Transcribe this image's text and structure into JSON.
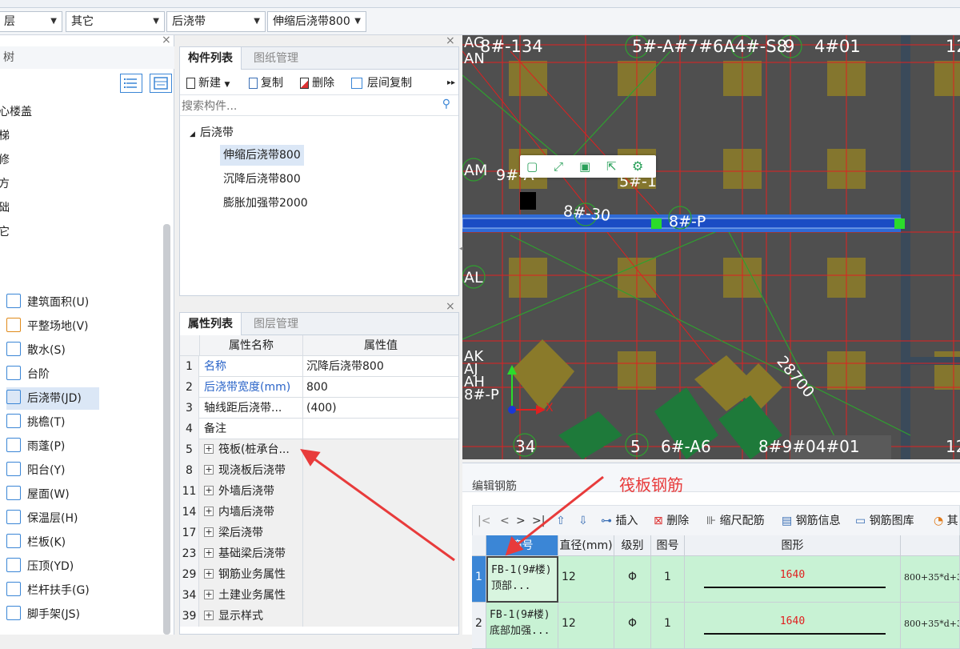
{
  "selectors": {
    "s1": "层",
    "s2": "其它",
    "s3": "后浇带",
    "s4": "伸缩后浇带800"
  },
  "left_tree": {
    "header": "树",
    "items": [
      "心楼盖",
      "梯",
      "修",
      "方",
      "础",
      "它"
    ],
    "tools": [
      {
        "label": "建筑面积(U)",
        "icon": "building-area-icon"
      },
      {
        "label": "平整场地(V)",
        "icon": "site-leveling-icon"
      },
      {
        "label": "散水(S)",
        "icon": "apron-icon"
      },
      {
        "label": "台阶",
        "icon": "step-icon"
      },
      {
        "label": "后浇带(JD)",
        "icon": "post-pour-strip-icon",
        "selected": true
      },
      {
        "label": "挑檐(T)",
        "icon": "cornice-icon"
      },
      {
        "label": "雨蓬(P)",
        "icon": "canopy-icon"
      },
      {
        "label": "阳台(Y)",
        "icon": "balcony-icon"
      },
      {
        "label": "屋面(W)",
        "icon": "roof-icon"
      },
      {
        "label": "保温层(H)",
        "icon": "insulation-icon"
      },
      {
        "label": "栏板(K)",
        "icon": "parapet-icon"
      },
      {
        "label": "压顶(YD)",
        "icon": "coping-icon"
      },
      {
        "label": "栏杆扶手(G)",
        "icon": "railing-icon"
      },
      {
        "label": "脚手架(JS)",
        "icon": "scaffold-icon"
      }
    ]
  },
  "component_panel": {
    "tabs": [
      "构件列表",
      "图纸管理"
    ],
    "toolbar": {
      "new": "新建",
      "copy": "复制",
      "delete": "删除",
      "floor_copy": "层间复制"
    },
    "search_placeholder": "搜索构件...",
    "group": "后浇带",
    "items": [
      "伸缩后浇带800",
      "沉降后浇带800",
      "膨胀加强带2000"
    ]
  },
  "property_panel": {
    "tabs": [
      "属性列表",
      "图层管理"
    ],
    "col_name": "属性名称",
    "col_value": "属性值",
    "rows": [
      {
        "num": "1",
        "name": "名称",
        "value": "沉降后浇带800",
        "blue": true
      },
      {
        "num": "2",
        "name": "后浇带宽度(mm)",
        "value": "800",
        "blue": true
      },
      {
        "num": "3",
        "name": "轴线距后浇带...",
        "value": "(400)"
      },
      {
        "num": "4",
        "name": "备注",
        "value": ""
      },
      {
        "num": "5",
        "name": "筏板(桩承台...",
        "value": "",
        "group": true
      },
      {
        "num": "8",
        "name": "现浇板后浇带",
        "value": "",
        "group": true
      },
      {
        "num": "11",
        "name": "外墙后浇带",
        "value": "",
        "group": true
      },
      {
        "num": "14",
        "name": "内墙后浇带",
        "value": "",
        "group": true
      },
      {
        "num": "17",
        "name": "梁后浇带",
        "value": "",
        "group": true
      },
      {
        "num": "23",
        "name": "基础梁后浇带",
        "value": "",
        "group": true
      },
      {
        "num": "29",
        "name": "钢筋业务属性",
        "value": "",
        "group": true
      },
      {
        "num": "34",
        "name": "土建业务属性",
        "value": "",
        "group": true
      },
      {
        "num": "39",
        "name": "显示样式",
        "value": "",
        "group": true
      }
    ]
  },
  "canvas": {
    "labels": {
      "ag_an": "AG\nAN",
      "t1": "8#-134",
      "t2": "5#-A#7#6A4#-S8",
      "t3": "9",
      "t4": "4#01",
      "t5": "12",
      "am": "AM",
      "l9": "9#-A",
      "l5": "5#-1",
      "l830": "8#-30",
      "l8p": "8#-P",
      "al": "AL",
      "ak": "AK\nAJ\nAH\n8#-P",
      "dim": "28700",
      "b34": "34",
      "b5": "5",
      "b6a6": "6#-A6",
      "b89": "8#9#04#01",
      "b12": "12",
      "axis_x": "X"
    },
    "float_tools": [
      "select-icon",
      "expand-icon",
      "save-view-icon",
      "export-icon",
      "settings-icon"
    ]
  },
  "annotation": {
    "label": "筏板钢筋",
    "color": "#e83b3b"
  },
  "rebar_editor": {
    "title": "编辑钢筋",
    "toolbar": [
      "插入",
      "删除",
      "缩尺配筋",
      "钢筋信息",
      "钢筋图库",
      "其"
    ],
    "columns": [
      "筋号",
      "直径(mm)",
      "级别",
      "图号",
      "图形"
    ],
    "rows": [
      {
        "idx": "1",
        "name": "FB-1(9#楼) 顶部...",
        "dia": "12",
        "grade": "Φ",
        "fig": "1",
        "len": "1640",
        "formula": "800+35*d+3"
      },
      {
        "idx": "2",
        "name": "FB-1(9#楼) 底部加强...",
        "dia": "12",
        "grade": "Φ",
        "fig": "1",
        "len": "1640",
        "formula": "800+35*d+3"
      }
    ]
  }
}
